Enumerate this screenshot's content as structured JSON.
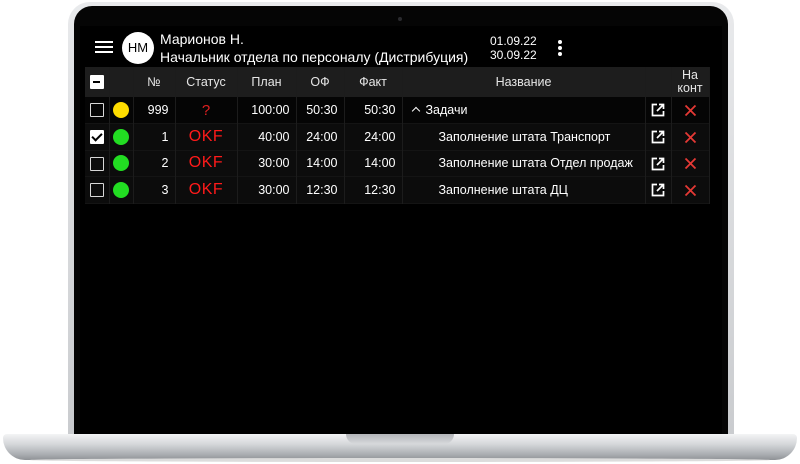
{
  "header": {
    "avatar_initials": "НМ",
    "user_name": "Марионов Н.",
    "user_role": "Начальник отдела по персоналу (Дистрибуция)",
    "date_from": "01.09.22",
    "date_to": "30.09.22",
    "menu_icon": "hamburger-menu-icon",
    "more_icon": "more-vertical-icon"
  },
  "table": {
    "columns": {
      "number": "№",
      "status": "Статус",
      "plan": "План",
      "of": "ОФ",
      "fact": "Факт",
      "name": "Название",
      "control_line1": "На",
      "control_line2": "конт"
    },
    "rows": [
      {
        "checked": false,
        "indicator_color": "#ffdd00",
        "number": "999",
        "status": "?",
        "plan": "100:00",
        "of": "50:30",
        "fact": "50:30",
        "name": "Задачи",
        "is_group": true
      },
      {
        "checked": true,
        "indicator_color": "#22dd22",
        "number": "1",
        "status": "OKF",
        "plan": "40:00",
        "of": "24:00",
        "fact": "24:00",
        "name": "Заполнение штата Транспорт",
        "is_group": false
      },
      {
        "checked": false,
        "indicator_color": "#22dd22",
        "number": "2",
        "status": "OKF",
        "plan": "30:00",
        "of": "14:00",
        "fact": "14:00",
        "name": "Заполнение штата Отдел продаж",
        "is_group": false
      },
      {
        "checked": false,
        "indicator_color": "#22dd22",
        "number": "3",
        "status": "OKF",
        "plan": "30:00",
        "of": "12:30",
        "fact": "12:30",
        "name": "Заполнение штата ДЦ",
        "is_group": false
      }
    ]
  },
  "colors": {
    "background": "#000000",
    "header_row": "#1d1d1d",
    "status_red": "#ff1a1a",
    "delete_red": "#e53935"
  }
}
